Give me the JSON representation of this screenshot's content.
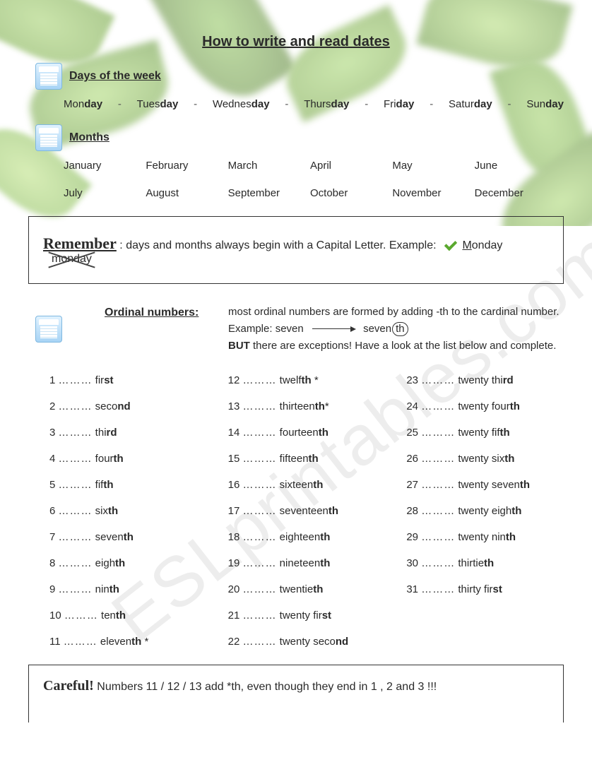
{
  "title": {
    "p1": "How to ",
    "b1": "write",
    "p2": " and ",
    "b2": "read",
    "p3": " dates"
  },
  "watermark": "ESLprintables.com",
  "sections": {
    "days_title": "Days of the week",
    "months_title": "Months",
    "ordinal_title": "Ordinal numbers:"
  },
  "days": [
    {
      "pre": "Mon",
      "suf": "day"
    },
    {
      "pre": "Tues",
      "suf": "day"
    },
    {
      "pre": "Wednes",
      "suf": "day"
    },
    {
      "pre": "Thurs",
      "suf": "day"
    },
    {
      "pre": "Fri",
      "suf": "day"
    },
    {
      "pre": "Satur",
      "suf": "day"
    },
    {
      "pre": "Sun",
      "suf": "day"
    }
  ],
  "sep": "-",
  "months": [
    "January",
    "February",
    "March",
    "April",
    "May",
    "June",
    "July",
    "August",
    "September",
    "October",
    "November",
    "December"
  ],
  "remember": {
    "label": "Remember",
    "text": " :  days and months always begin with a Capital Letter. Example: ",
    "good_cap": "M",
    "good_rest": "onday",
    "bad": "monday"
  },
  "ordinal_intro": {
    "line1": "most ordinal numbers are formed by adding    -th  to the cardinal number.",
    "line2_pre": "Example:   seven",
    "line2_post_base": "seven",
    "line2_post_suf": "th",
    "line3_pre": "BUT",
    "line3_post": " there are exceptions! Have a look at the list below and complete."
  },
  "ordinals": [
    {
      "n": "1",
      "base": "fir",
      "suf": "st",
      "star": ""
    },
    {
      "n": "2",
      "base": "seco",
      "suf": "nd",
      "star": ""
    },
    {
      "n": "3",
      "base": "thi",
      "suf": "rd",
      "star": ""
    },
    {
      "n": "4",
      "base": "four",
      "suf": "th",
      "star": ""
    },
    {
      "n": "5",
      "base": "fif",
      "suf": "th",
      "star": ""
    },
    {
      "n": "6",
      "base": "six",
      "suf": "th",
      "star": ""
    },
    {
      "n": "7",
      "base": "seven",
      "suf": "th",
      "star": ""
    },
    {
      "n": "8",
      "base": "eigh",
      "suf": "th",
      "star": ""
    },
    {
      "n": "9",
      "base": "nin",
      "suf": "th",
      "star": ""
    },
    {
      "n": "10",
      "base": "ten",
      "suf": "th",
      "star": ""
    },
    {
      "n": "11",
      "base": "eleven",
      "suf": "th",
      "star": " *"
    },
    {
      "n": "12",
      "base": "twelf",
      "suf": "th",
      "star": " *"
    },
    {
      "n": "13",
      "base": "thirteen",
      "suf": "th",
      "star": "*"
    },
    {
      "n": "14",
      "base": "fourteen",
      "suf": "th",
      "star": ""
    },
    {
      "n": "15",
      "base": "fifteen",
      "suf": "th",
      "star": ""
    },
    {
      "n": "16",
      "base": "sixteen",
      "suf": "th",
      "star": ""
    },
    {
      "n": "17",
      "base": "seventeen",
      "suf": "th",
      "star": ""
    },
    {
      "n": "18",
      "base": "eighteen",
      "suf": "th",
      "star": ""
    },
    {
      "n": "19",
      "base": "nineteen",
      "suf": "th",
      "star": ""
    },
    {
      "n": "20",
      "base": "twentie",
      "suf": "th",
      "star": ""
    },
    {
      "n": "21",
      "base": "twenty fir",
      "suf": "st",
      "star": ""
    },
    {
      "n": "22",
      "base": "twenty seco",
      "suf": "nd",
      "star": ""
    },
    {
      "n": "23",
      "base": "twenty thi",
      "suf": "rd",
      "star": ""
    },
    {
      "n": "24",
      "base": "twenty four",
      "suf": "th",
      "star": ""
    },
    {
      "n": "25",
      "base": "twenty fif",
      "suf": "th",
      "star": ""
    },
    {
      "n": "26",
      "base": "twenty six",
      "suf": "th",
      "star": ""
    },
    {
      "n": "27",
      "base": "twenty seven",
      "suf": "th",
      "star": ""
    },
    {
      "n": "28",
      "base": "twenty eigh",
      "suf": "th",
      "star": ""
    },
    {
      "n": "29",
      "base": "twenty nin",
      "suf": "th",
      "star": ""
    },
    {
      "n": "30",
      "base": "thirtie",
      "suf": "th",
      "star": ""
    },
    {
      "n": "31",
      "base": "thirty fir",
      "suf": "st",
      "star": ""
    }
  ],
  "careful": {
    "label": "Careful!",
    "text": "   Numbers   11  /  12 /  13   add  *th, even though they end in  1 ,  2  and  3 !!!"
  }
}
